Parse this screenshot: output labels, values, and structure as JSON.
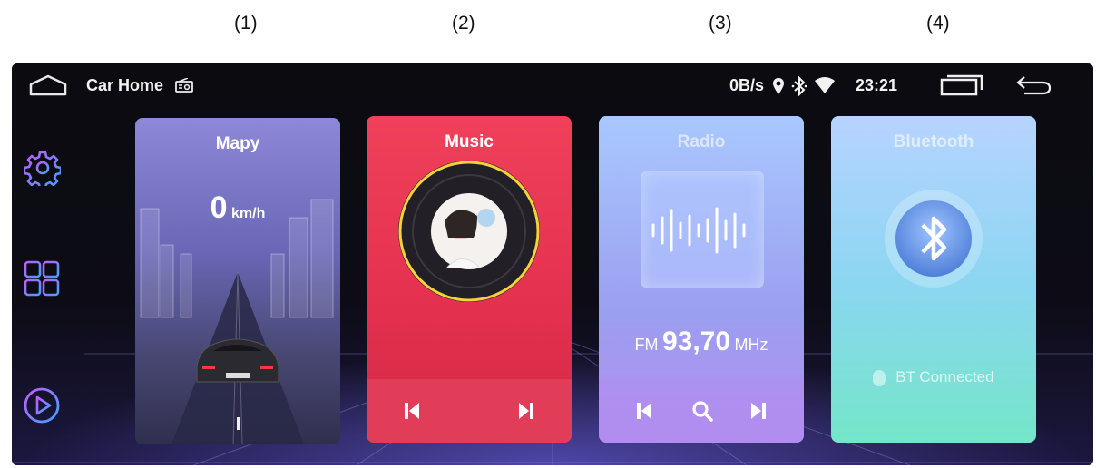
{
  "captions": [
    "(1)",
    "(2)",
    "(3)",
    "(4)"
  ],
  "topbar": {
    "title": "Car Home",
    "net_speed": "0B/s",
    "time": "23:21"
  },
  "cards": {
    "maps": {
      "title": "Mapy",
      "speed_value": "0",
      "speed_unit": "km/h"
    },
    "music": {
      "title": "Music"
    },
    "radio": {
      "title": "Radio",
      "band": "FM",
      "frequency": "93,70",
      "unit": "MHz"
    },
    "bluetooth": {
      "title": "Bluetooth",
      "status": "BT Connected"
    }
  },
  "colors": {
    "music_card": "#e3304f",
    "accent_purple": "#c04bff",
    "accent_blue": "#3fa2ff"
  },
  "icons": [
    "home-icon",
    "radio-icon",
    "location-icon",
    "bluetooth-icon",
    "wifi-icon",
    "recent-apps-icon",
    "back-icon",
    "settings-icon",
    "apps-grid-icon",
    "play-icon",
    "prev-icon",
    "next-icon",
    "search-icon"
  ]
}
